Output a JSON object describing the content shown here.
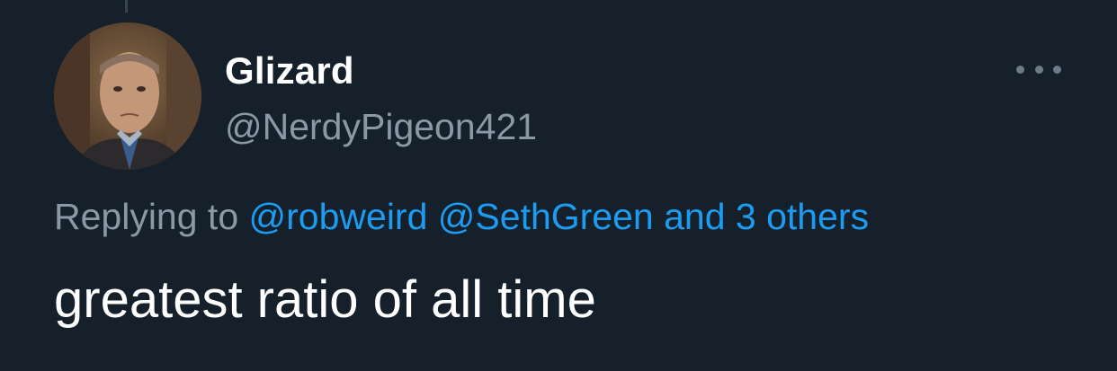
{
  "tweet": {
    "author": {
      "display_name": "Glizard",
      "handle": "@NerdyPigeon421",
      "avatar_icon": "profile-photo"
    },
    "more_icon": "ellipsis-icon",
    "reply_context": {
      "prefix": "Replying to",
      "mentions": [
        "@robweird",
        "@SethGreen"
      ],
      "others": "and 3 others"
    },
    "text": "greatest ratio of all time"
  },
  "colors": {
    "background": "#15202b",
    "primary_text": "#ffffff",
    "secondary_text": "#8b98a5",
    "link": "#1d9bf0"
  }
}
